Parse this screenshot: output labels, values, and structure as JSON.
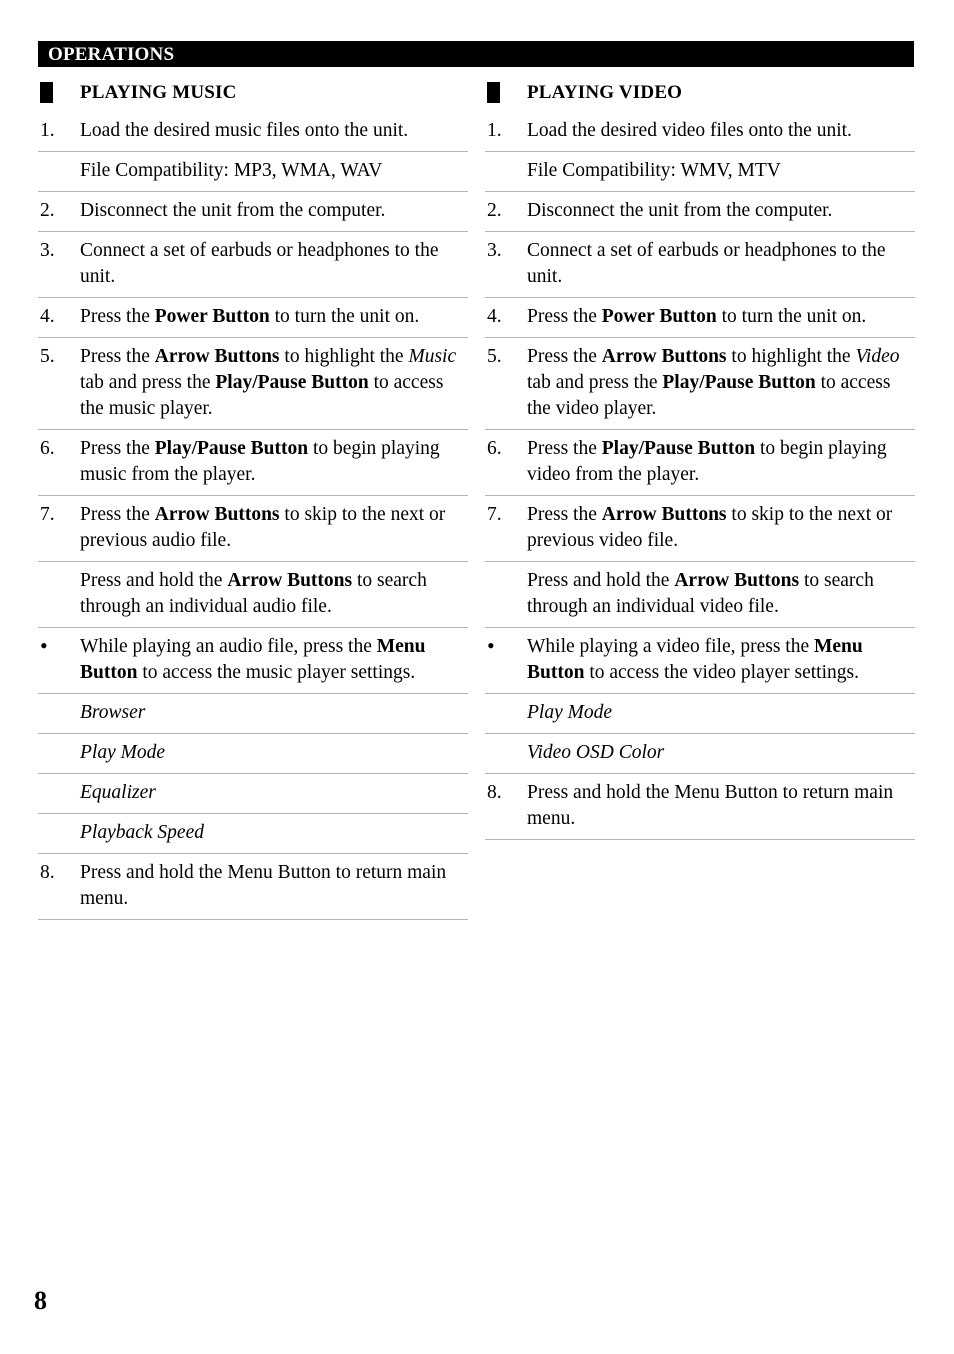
{
  "header": {
    "title": "OPERATIONS"
  },
  "page_number": "8",
  "columns": [
    {
      "section_title": "PLAYING MUSIC",
      "rows": [
        {
          "marker": "1.",
          "text_html": "Load the desired music files onto the unit."
        },
        {
          "marker": "",
          "text_html": "File Compatibility: MP3, WMA, WAV"
        },
        {
          "marker": "2.",
          "text_html": "Disconnect the unit from the computer."
        },
        {
          "marker": "3.",
          "text_html": "Connect a set of earbuds or headphones to the unit."
        },
        {
          "marker": "4.",
          "text_html": "Press the <b>Power Button</b> to turn the unit on."
        },
        {
          "marker": "5.",
          "text_html": "Press the <b>Arrow Buttons</b> to highlight the <i>Music</i> tab and press the <b>Play/Pause Button</b> to access the music player."
        },
        {
          "marker": "6.",
          "text_html": "Press the <b>Play/Pause Button</b> to begin playing music from the player."
        },
        {
          "marker": "7.",
          "text_html": "Press the <b>Arrow Buttons</b> to skip to the next or previous audio file."
        },
        {
          "marker": "",
          "text_html": "Press and hold the <b>Arrow Buttons</b> to search through an individual audio file."
        },
        {
          "marker": "•",
          "text_html": "While playing an audio file, press the <b>Menu Button</b> to access the music player settings.",
          "bullet": true
        },
        {
          "marker": "",
          "text_html": "Browser",
          "italic": true
        },
        {
          "marker": "",
          "text_html": "Play Mode",
          "italic": true
        },
        {
          "marker": "",
          "text_html": "Equalizer",
          "italic": true
        },
        {
          "marker": "",
          "text_html": "Playback Speed",
          "italic": true
        },
        {
          "marker": "8.",
          "text_html": "Press and hold the Menu Button to return main menu."
        }
      ]
    },
    {
      "section_title": "PLAYING VIDEO",
      "rows": [
        {
          "marker": "1.",
          "text_html": "Load the desired video files onto the unit."
        },
        {
          "marker": "",
          "text_html": "File Compatibility: WMV, MTV"
        },
        {
          "marker": "2.",
          "text_html": "Disconnect the unit from the computer."
        },
        {
          "marker": "3.",
          "text_html": "Connect a set of earbuds or headphones to the unit."
        },
        {
          "marker": "4.",
          "text_html": "Press the <b>Power Button</b> to turn the unit on."
        },
        {
          "marker": "5.",
          "text_html": "Press the <b>Arrow Buttons</b> to highlight the <i>Video</i> tab and press the <b>Play/Pause Button</b> to access the video player."
        },
        {
          "marker": "6.",
          "text_html": "Press the <b>Play/Pause Button</b> to begin playing video from the player."
        },
        {
          "marker": "7.",
          "text_html": "Press the <b>Arrow Buttons</b> to skip to the next or previous video file."
        },
        {
          "marker": "",
          "text_html": "Press and hold the <b>Arrow Buttons</b> to search through an individual video file."
        },
        {
          "marker": "•",
          "text_html": "While playing a video file, press the <b>Menu Button</b> to access the video player settings.",
          "bullet": true
        },
        {
          "marker": "",
          "text_html": "Play Mode",
          "italic": true
        },
        {
          "marker": "",
          "text_html": "Video OSD Color",
          "italic": true
        },
        {
          "marker": "8.",
          "text_html": "Press and hold the Menu Button to return main menu."
        }
      ]
    }
  ]
}
